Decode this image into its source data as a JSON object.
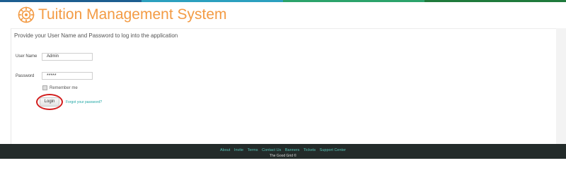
{
  "theme": {
    "accent": "#f39b44",
    "link": "#21a7a5",
    "footer_bg": "#232b2a",
    "highlight": "#d21d1d"
  },
  "top_stripe": [
    "#1d5e90",
    "#2ca0bf",
    "#2ba36b",
    "#1f7a3c"
  ],
  "header": {
    "title": "Tuition Management System",
    "logo_icon": "cog-logo-icon"
  },
  "login": {
    "intro": "Provide your User Name and Password to log into the application",
    "username_label": "User Name",
    "username_value": "Admin",
    "password_label": "Password",
    "password_value": "*****",
    "remember_label": "Remember me",
    "remember_checked": false,
    "login_label": "Login",
    "forgot_label": "Forgot your password?"
  },
  "footer": {
    "links": [
      "About",
      "Invite",
      "Terms",
      "Contact Us",
      "Banners",
      "Tickets",
      "Support Center"
    ],
    "copyright": "The Good Grid ©"
  }
}
